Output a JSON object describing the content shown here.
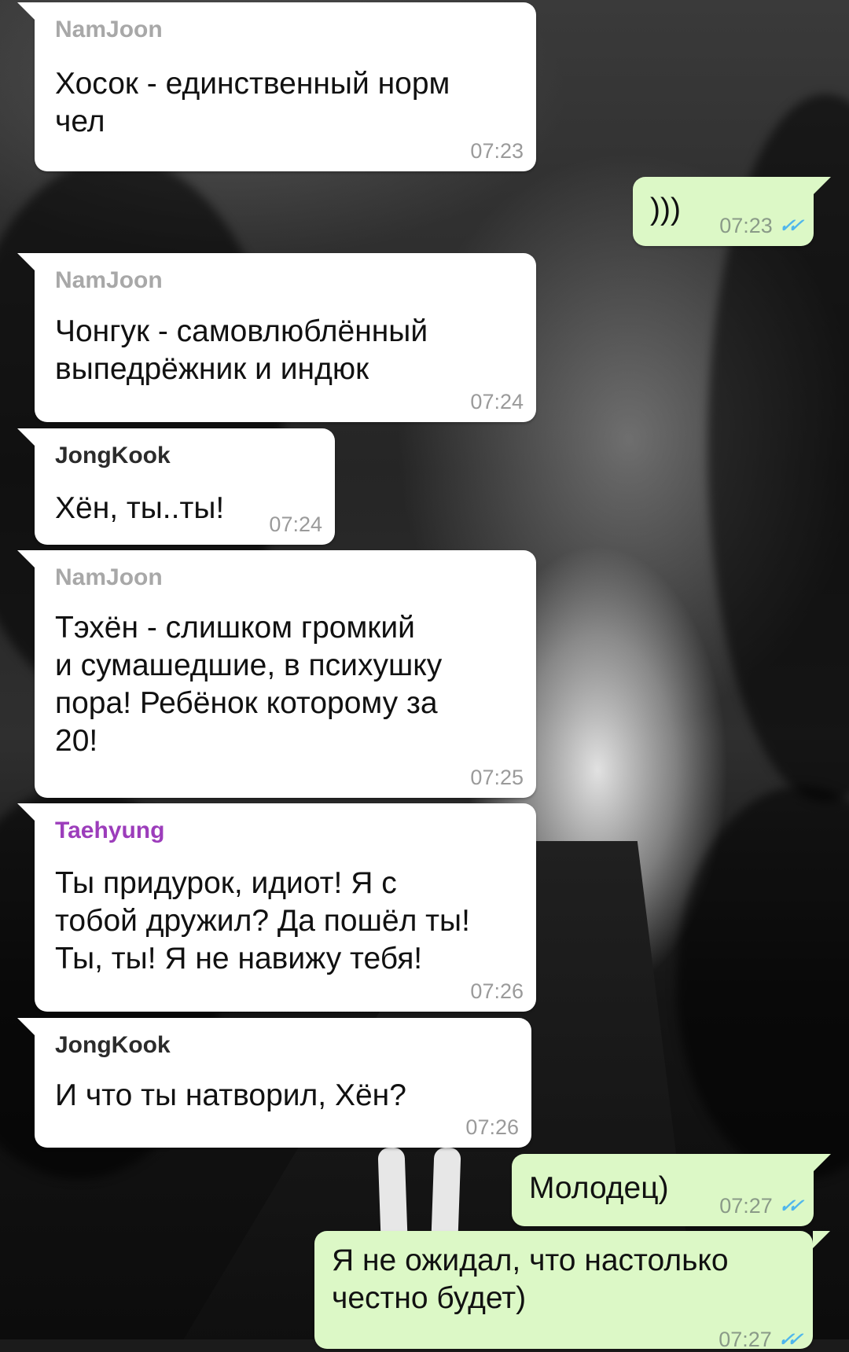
{
  "messages": [
    {
      "sender": "NamJoon",
      "text": "Хосок - единственный норм\nчел",
      "time": "07:23"
    },
    {
      "text": ")))",
      "time": "07:23"
    },
    {
      "sender": "NamJoon",
      "text": "Чонгук - самовлюблённый\nвыпедрёжник и индюк",
      "time": "07:24"
    },
    {
      "sender": "JongKook",
      "text": "Хён, ты..ты!",
      "time": "07:24"
    },
    {
      "sender": "NamJoon",
      "text": "Тэхён - слишком громкий\nи сумашедшие, в психушку\nпора! Ребёнок которому за\n20!",
      "time": "07:25"
    },
    {
      "sender": "Taehyung",
      "text": "Ты придурок, идиот! Я с\nтобой дружил? Да пошёл ты!\nТы, ты! Я не навижу тебя!",
      "time": "07:26"
    },
    {
      "sender": "JongKook",
      "text": "И что ты натворил, Хён?",
      "time": "07:26"
    },
    {
      "text": "Молодец)",
      "time": "07:27"
    },
    {
      "text": "Я не ожидал, что настолько\nчестно будет)",
      "time": "07:27"
    }
  ],
  "colors": {
    "incoming_bubble": "#ffffff",
    "outgoing_bubble": "#dcf8c6",
    "read_ticks": "#4fb6ec",
    "taehyung_name": "#9c3dbb"
  },
  "icons": {
    "read_receipt": "double-check-icon"
  }
}
